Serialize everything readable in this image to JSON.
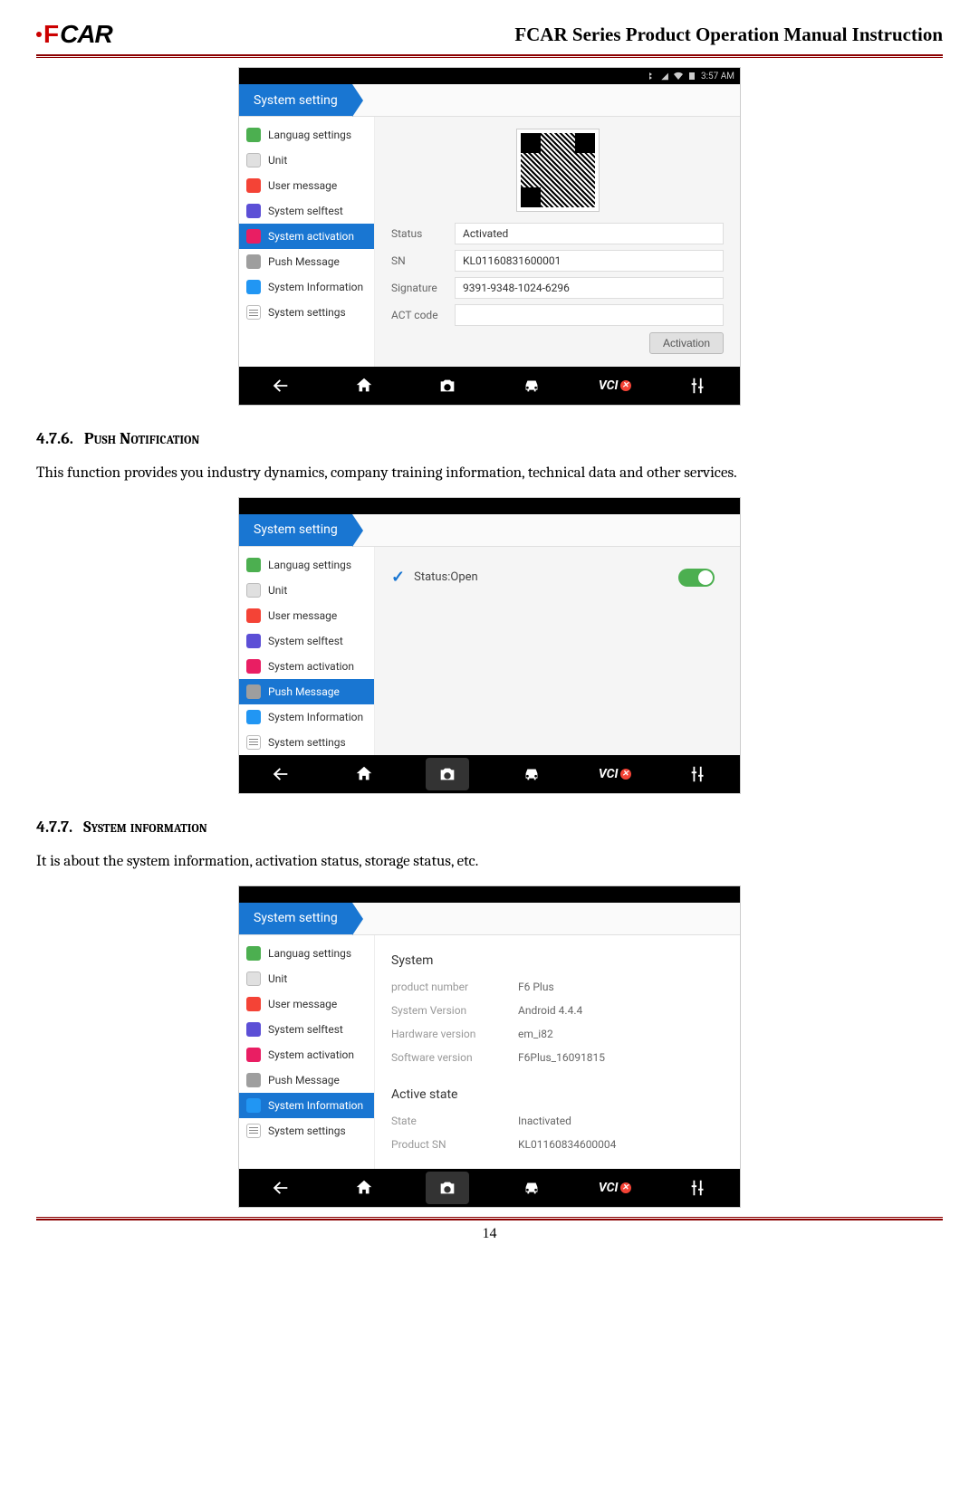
{
  "header": {
    "logo_f": "F",
    "logo_car": "CAR",
    "title": "FCAR Series Product  Operation Manual Instruction"
  },
  "page_number": "14",
  "status_bar_time": "3:57 AM",
  "tab_label": "System setting",
  "sidebar": [
    {
      "label": "Languag settings",
      "ico": "ic-green"
    },
    {
      "label": "Unit",
      "ico": "ic-grey"
    },
    {
      "label": "User message",
      "ico": "ic-red"
    },
    {
      "label": "System selftest",
      "ico": "ic-purple"
    },
    {
      "label": "System activation",
      "ico": "ic-pink"
    },
    {
      "label": "Push Message",
      "ico": "ic-darkgrey"
    },
    {
      "label": "System Information",
      "ico": "ic-info"
    },
    {
      "label": "System settings",
      "ico": "ic-lines"
    }
  ],
  "section1": {
    "activation": {
      "status_k": "Status",
      "status_v": "Activated",
      "sn_k": "SN",
      "sn_v": "KL01160831600001",
      "sig_k": "Signature",
      "sig_v": "9391-9348-1024-6296",
      "act_k": "ACT code",
      "act_v": "",
      "button": "Activation"
    }
  },
  "section2": {
    "num": "4.7.6.",
    "title": "Push Notification",
    "text": "This function provides you industry dynamics, company training information, technical data and other services.",
    "status_label": "Status:Open"
  },
  "section3": {
    "num": "4.7.7.",
    "title": "System information",
    "text": "It is about the system information, activation status, storage status, etc.",
    "sys_title": "System",
    "rows_sys": [
      {
        "k": "product number",
        "v": "F6 Plus"
      },
      {
        "k": "System Version",
        "v": "Android 4.4.4"
      },
      {
        "k": "Hardware version",
        "v": "em_i82"
      },
      {
        "k": "Software version",
        "v": "F6Plus_16091815"
      }
    ],
    "active_title": "Active state",
    "rows_act": [
      {
        "k": "State",
        "v": "Inactivated"
      },
      {
        "k": "Product SN",
        "v": "KL01160834600004"
      }
    ]
  },
  "bottombar_vci": "VCI"
}
